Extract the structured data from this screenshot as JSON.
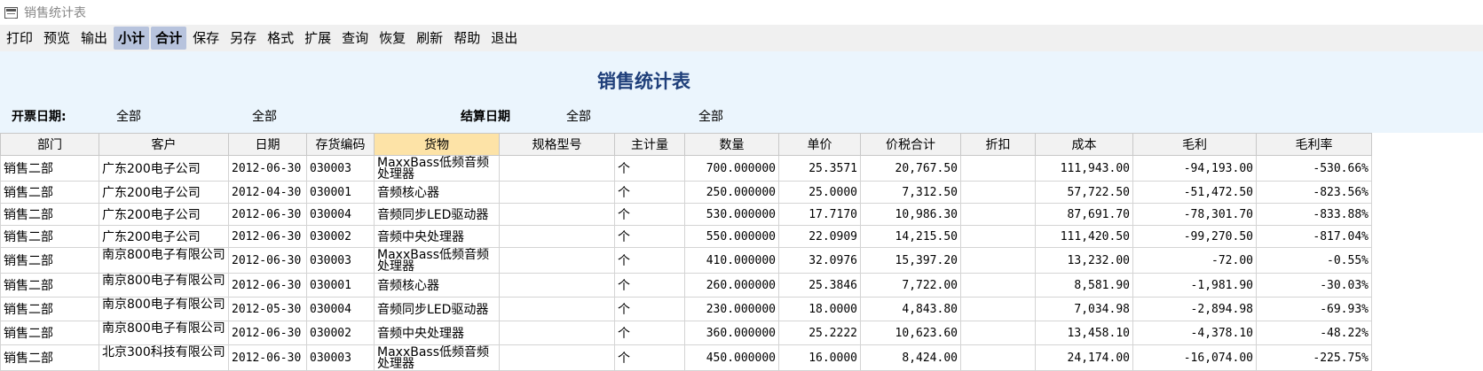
{
  "window": {
    "title": "销售统计表"
  },
  "toolbar": {
    "items": [
      "打印",
      "预览",
      "输出",
      "小计",
      "合计",
      "保存",
      "另存",
      "格式",
      "扩展",
      "查询",
      "恢复",
      "刷新",
      "帮助",
      "退出"
    ]
  },
  "report": {
    "title": "销售统计表",
    "filters": {
      "invoice_date_label": "开票日期:",
      "invoice_from": "全部",
      "invoice_to": "全部",
      "settle_date_label": "结算日期",
      "settle_from": "全部",
      "settle_to": "全部"
    }
  },
  "table": {
    "columns": [
      "部门",
      "客户",
      "日期",
      "存货编码",
      "货物",
      "规格型号",
      "主计量",
      "数量",
      "单价",
      "价税合计",
      "折扣",
      "成本",
      "毛利",
      "毛利率"
    ],
    "rows": [
      [
        "销售二部",
        "广东200电子公司",
        "2012-06-30",
        "030003",
        "MaxxBass低频音频处理器",
        "",
        "个",
        "700.000000",
        "25.3571",
        "20,767.50",
        "",
        "111,943.00",
        "-94,193.00",
        "-530.66%"
      ],
      [
        "销售二部",
        "广东200电子公司",
        "2012-04-30",
        "030001",
        "音频核心器",
        "",
        "个",
        "250.000000",
        "25.0000",
        "7,312.50",
        "",
        "57,722.50",
        "-51,472.50",
        "-823.56%"
      ],
      [
        "销售二部",
        "广东200电子公司",
        "2012-06-30",
        "030004",
        "音频同步LED驱动器",
        "",
        "个",
        "530.000000",
        "17.7170",
        "10,986.30",
        "",
        "87,691.70",
        "-78,301.70",
        "-833.88%"
      ],
      [
        "销售二部",
        "广东200电子公司",
        "2012-06-30",
        "030002",
        "音频中央处理器",
        "",
        "个",
        "550.000000",
        "22.0909",
        "14,215.50",
        "",
        "111,420.50",
        "-99,270.50",
        "-817.04%"
      ],
      [
        "销售二部",
        "南京800电子有限公司",
        "2012-06-30",
        "030003",
        "MaxxBass低频音频处理器",
        "",
        "个",
        "410.000000",
        "32.0976",
        "15,397.20",
        "",
        "13,232.00",
        "-72.00",
        "-0.55%"
      ],
      [
        "销售二部",
        "南京800电子有限公司",
        "2012-06-30",
        "030001",
        "音频核心器",
        "",
        "个",
        "260.000000",
        "25.3846",
        "7,722.00",
        "",
        "8,581.90",
        "-1,981.90",
        "-30.03%"
      ],
      [
        "销售二部",
        "南京800电子有限公司",
        "2012-05-30",
        "030004",
        "音频同步LED驱动器",
        "",
        "个",
        "230.000000",
        "18.0000",
        "4,843.80",
        "",
        "7,034.98",
        "-2,894.98",
        "-69.93%"
      ],
      [
        "销售二部",
        "南京800电子有限公司",
        "2012-06-30",
        "030002",
        "音频中央处理器",
        "",
        "个",
        "360.000000",
        "25.2222",
        "10,623.60",
        "",
        "13,458.10",
        "-4,378.10",
        "-48.22%"
      ],
      [
        "销售二部",
        "北京300科技有限公司",
        "2012-06-30",
        "030003",
        "MaxxBass低频音频处理器",
        "",
        "个",
        "450.000000",
        "16.0000",
        "8,424.00",
        "",
        "24,174.00",
        "-16,074.00",
        "-225.75%"
      ]
    ]
  }
}
